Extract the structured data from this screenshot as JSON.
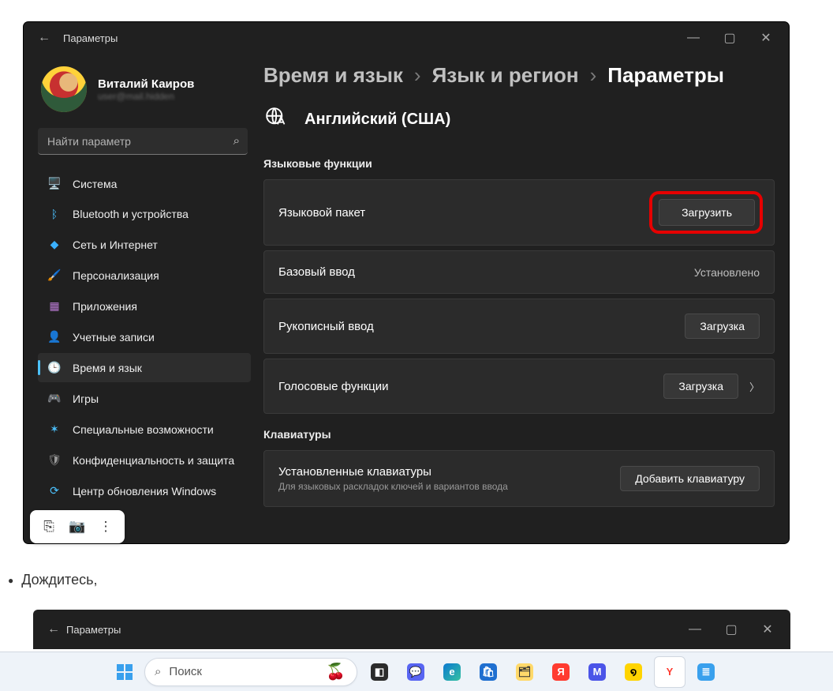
{
  "window": {
    "title": "Параметры",
    "user_name": "Виталий Каиров",
    "user_email": "user@mail.hidden",
    "search_placeholder": "Найти параметр",
    "nav": [
      {
        "label": "Система",
        "icon": "🖥️",
        "color": "#4cc2ff"
      },
      {
        "label": "Bluetooth и устройства",
        "icon": "ᛒ",
        "color": "#4cc2ff"
      },
      {
        "label": "Сеть и Интернет",
        "icon": "◆",
        "color": "#3ab0ff"
      },
      {
        "label": "Персонализация",
        "icon": "🖌️",
        "color": "#d08a3a"
      },
      {
        "label": "Приложения",
        "icon": "▦",
        "color": "#b87ad1"
      },
      {
        "label": "Учетные записи",
        "icon": "👤",
        "color": "#6bc46b"
      },
      {
        "label": "Время и язык",
        "icon": "🕒",
        "color": "#4cc2ff"
      },
      {
        "label": "Игры",
        "icon": "🎮",
        "color": "#9a9a9a"
      },
      {
        "label": "Специальные возможности",
        "icon": "✶",
        "color": "#4cc2ff"
      },
      {
        "label": "Конфиденциальность и защита",
        "icon": "🛡",
        "color": "#9a9a9a"
      },
      {
        "label": "Центр обновления Windows",
        "icon": "⟳",
        "color": "#4cc2ff"
      }
    ],
    "breadcrumb": [
      "Время и язык",
      "Язык и регион",
      "Параметры"
    ],
    "language_name": "Английский (США)",
    "features_section": "Языковые функции",
    "keyboards_section": "Клавиатуры",
    "rows": {
      "pack": {
        "label": "Языковой пакет",
        "btn": "Загрузить"
      },
      "basic": {
        "label": "Базовый ввод",
        "status": "Установлено"
      },
      "handwrite": {
        "label": "Рукописный ввод",
        "btn": "Загрузка"
      },
      "voice": {
        "label": "Голосовые функции",
        "btn": "Загрузка"
      },
      "kbd": {
        "label": "Установленные клавиатуры",
        "sub": "Для языковых раскладок ключей и вариантов ввода",
        "btn": "Добавить клавиатуру"
      }
    }
  },
  "bullet_text": "Дождитесь,",
  "window2": {
    "title": "Параметры"
  },
  "taskbar": {
    "search_placeholder": "Поиск",
    "icons": [
      {
        "name": "task-view",
        "glyph": "◧",
        "bg": "#2b2b2b",
        "fg": "#fff"
      },
      {
        "name": "chat",
        "glyph": "💬",
        "bg": "#5865f2",
        "fg": "#fff"
      },
      {
        "name": "edge",
        "glyph": "e",
        "bg": "linear-gradient(135deg,#0b79d0,#35c2a1)",
        "fg": "#fff"
      },
      {
        "name": "store",
        "glyph": "🛍",
        "bg": "#1f6fd0",
        "fg": "#fff"
      },
      {
        "name": "explorer",
        "glyph": "🗂",
        "bg": "#ffd96a",
        "fg": "#333"
      },
      {
        "name": "yandex-disk",
        "glyph": "Я",
        "bg": "#ff3b30",
        "fg": "#fff"
      },
      {
        "name": "app-m",
        "glyph": "M",
        "bg": "#4b54e8",
        "fg": "#fff"
      },
      {
        "name": "app-swirl",
        "glyph": "໑",
        "bg": "#ffd400",
        "fg": "#000"
      },
      {
        "name": "yandex-br",
        "glyph": "Y",
        "bg": "#ffffff",
        "fg": "#ff3b30",
        "active": true
      },
      {
        "name": "tray",
        "glyph": "≣",
        "bg": "#39a0ed",
        "fg": "#fff"
      }
    ]
  }
}
